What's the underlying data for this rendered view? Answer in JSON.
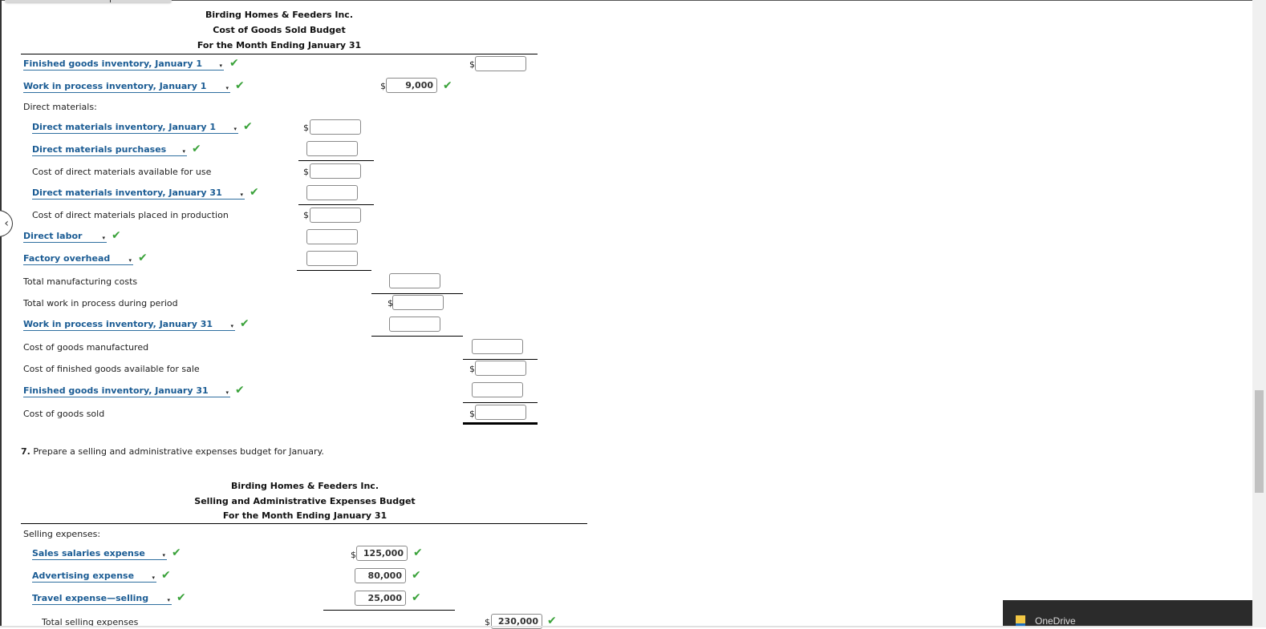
{
  "cogs_budget": {
    "company": "Birding Homes & Feeders Inc.",
    "title": "Cost of Goods Sold Budget",
    "period": "For the Month Ending January 31",
    "rows": {
      "fg_jan1": {
        "label": "Finished goods inventory, January 1",
        "value": ""
      },
      "wip_jan1": {
        "label": "Work in process inventory, January 1",
        "value": "9,000"
      },
      "dm_heading": "Direct materials:",
      "dm_jan1": {
        "label": "Direct materials inventory, January 1",
        "value": ""
      },
      "dm_purchases": {
        "label": "Direct materials purchases",
        "value": ""
      },
      "dm_available": {
        "label": "Cost of direct materials available for use",
        "value": ""
      },
      "dm_jan31": {
        "label": "Direct materials inventory, January 31",
        "value": ""
      },
      "dm_placed": {
        "label": "Cost of direct materials placed in production",
        "value": ""
      },
      "direct_labor": {
        "label": "Direct labor",
        "value": ""
      },
      "factory_overhead": {
        "label": "Factory overhead",
        "value": ""
      },
      "total_mfg": {
        "label": "Total manufacturing costs",
        "value": ""
      },
      "total_wip": {
        "label": "Total work in process during period",
        "value": ""
      },
      "wip_jan31": {
        "label": "Work in process inventory, January 31",
        "value": ""
      },
      "cogm": {
        "label": "Cost of goods manufactured",
        "value": ""
      },
      "fg_available": {
        "label": "Cost of finished goods available for sale",
        "value": ""
      },
      "fg_jan31": {
        "label": "Finished goods inventory, January 31",
        "value": ""
      },
      "cogs": {
        "label": "Cost of goods sold",
        "value": ""
      }
    }
  },
  "question7": {
    "number": "7.",
    "text": "Prepare a selling and administrative expenses budget for January."
  },
  "sa_budget": {
    "company": "Birding Homes & Feeders Inc.",
    "title": "Selling and Administrative Expenses Budget",
    "period": "For the Month Ending January 31",
    "selling_heading": "Selling expenses:",
    "rows": {
      "sales_salaries": {
        "label": "Sales salaries expense",
        "value": "125,000"
      },
      "advertising": {
        "label": "Advertising expense",
        "value": "80,000"
      },
      "travel": {
        "label": "Travel expense—selling",
        "value": "25,000"
      },
      "total_selling": {
        "label": "Total selling expenses",
        "value": "230,000"
      }
    }
  },
  "symbols": {
    "dollar": "$",
    "check": "✔",
    "caret": "▾",
    "back": "‹"
  },
  "notification": {
    "app": "OneDrive"
  }
}
